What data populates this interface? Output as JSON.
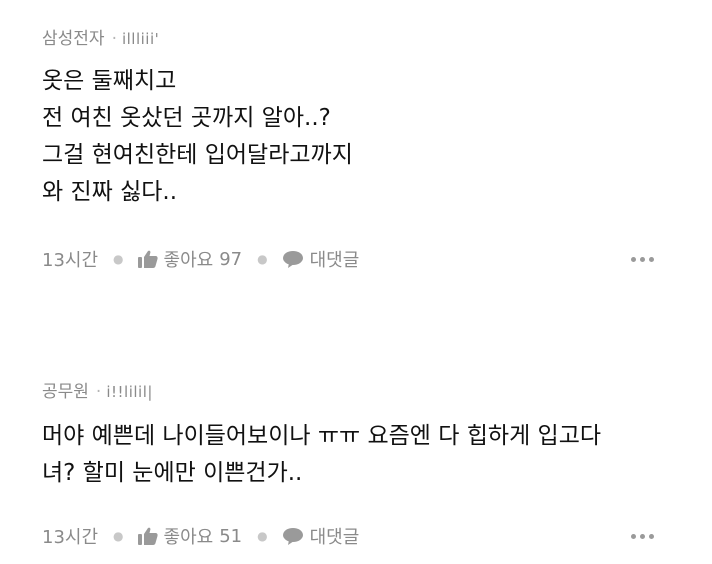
{
  "comments": [
    {
      "author": "삼성전자",
      "separator": "·",
      "nickname": "illliii'",
      "lines": [
        "옷은 둘째치고",
        "전 여친 옷샀던 곳까지 알아..?",
        "그걸 현여친한테 입어달라고까지",
        "와 진짜 싫다.."
      ],
      "time": "13시간",
      "like_label": "좋아요",
      "like_count": "97",
      "reply_label": "대댓글"
    },
    {
      "author": "공무원",
      "separator": "·",
      "nickname": "i!!lilil|",
      "lines": [
        "머야 예쁜데 나이들어보이나 ㅠㅠ 요즘엔 다 힙하게 입고다",
        "녀? 할미 눈에만 이쁜건가.."
      ],
      "time": "13시간",
      "like_label": "좋아요",
      "like_count": "51",
      "reply_label": "대댓글"
    }
  ],
  "icons": {
    "like": "thumbs-up-icon",
    "reply": "speech-bubble-icon",
    "more": "more-dots-icon"
  },
  "colors": {
    "meta_text": "#8a8a8a",
    "body_text": "#111111",
    "background": "#ffffff"
  }
}
